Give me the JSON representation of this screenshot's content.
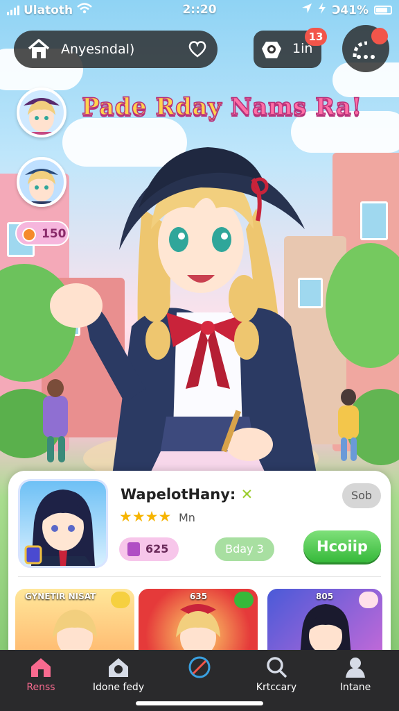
{
  "status_bar": {
    "carrier": "Ulatoth",
    "time": "2::20",
    "battery": "Ͻ41%"
  },
  "top_bar": {
    "search_label": "Anyesndal)",
    "message_count": "1in",
    "message_badge": "13"
  },
  "side": {
    "coins": "150"
  },
  "title": {
    "part1": "Pade Rday",
    "part2": "Nams Ra!"
  },
  "card": {
    "name": "WapelotHany:",
    "rating_stars": "★★★★",
    "rating_label": "Mn",
    "sob_label": "Sob",
    "gems": "625",
    "day_label": "Bday 3",
    "help_label": "Hcoiip",
    "thumbs": [
      {
        "label": "GYNETIR NISAT"
      },
      {
        "label": "635"
      },
      {
        "label": "805"
      }
    ]
  },
  "nav": {
    "items": [
      {
        "label": "Renss"
      },
      {
        "label": "Idone fedy"
      },
      {
        "label": ""
      },
      {
        "label": "Krtccary"
      },
      {
        "label": "Intane"
      }
    ]
  },
  "colors": {
    "accent_pink": "#f86a8f",
    "green_button": "#36b93a",
    "badge_red": "#f2554a"
  }
}
